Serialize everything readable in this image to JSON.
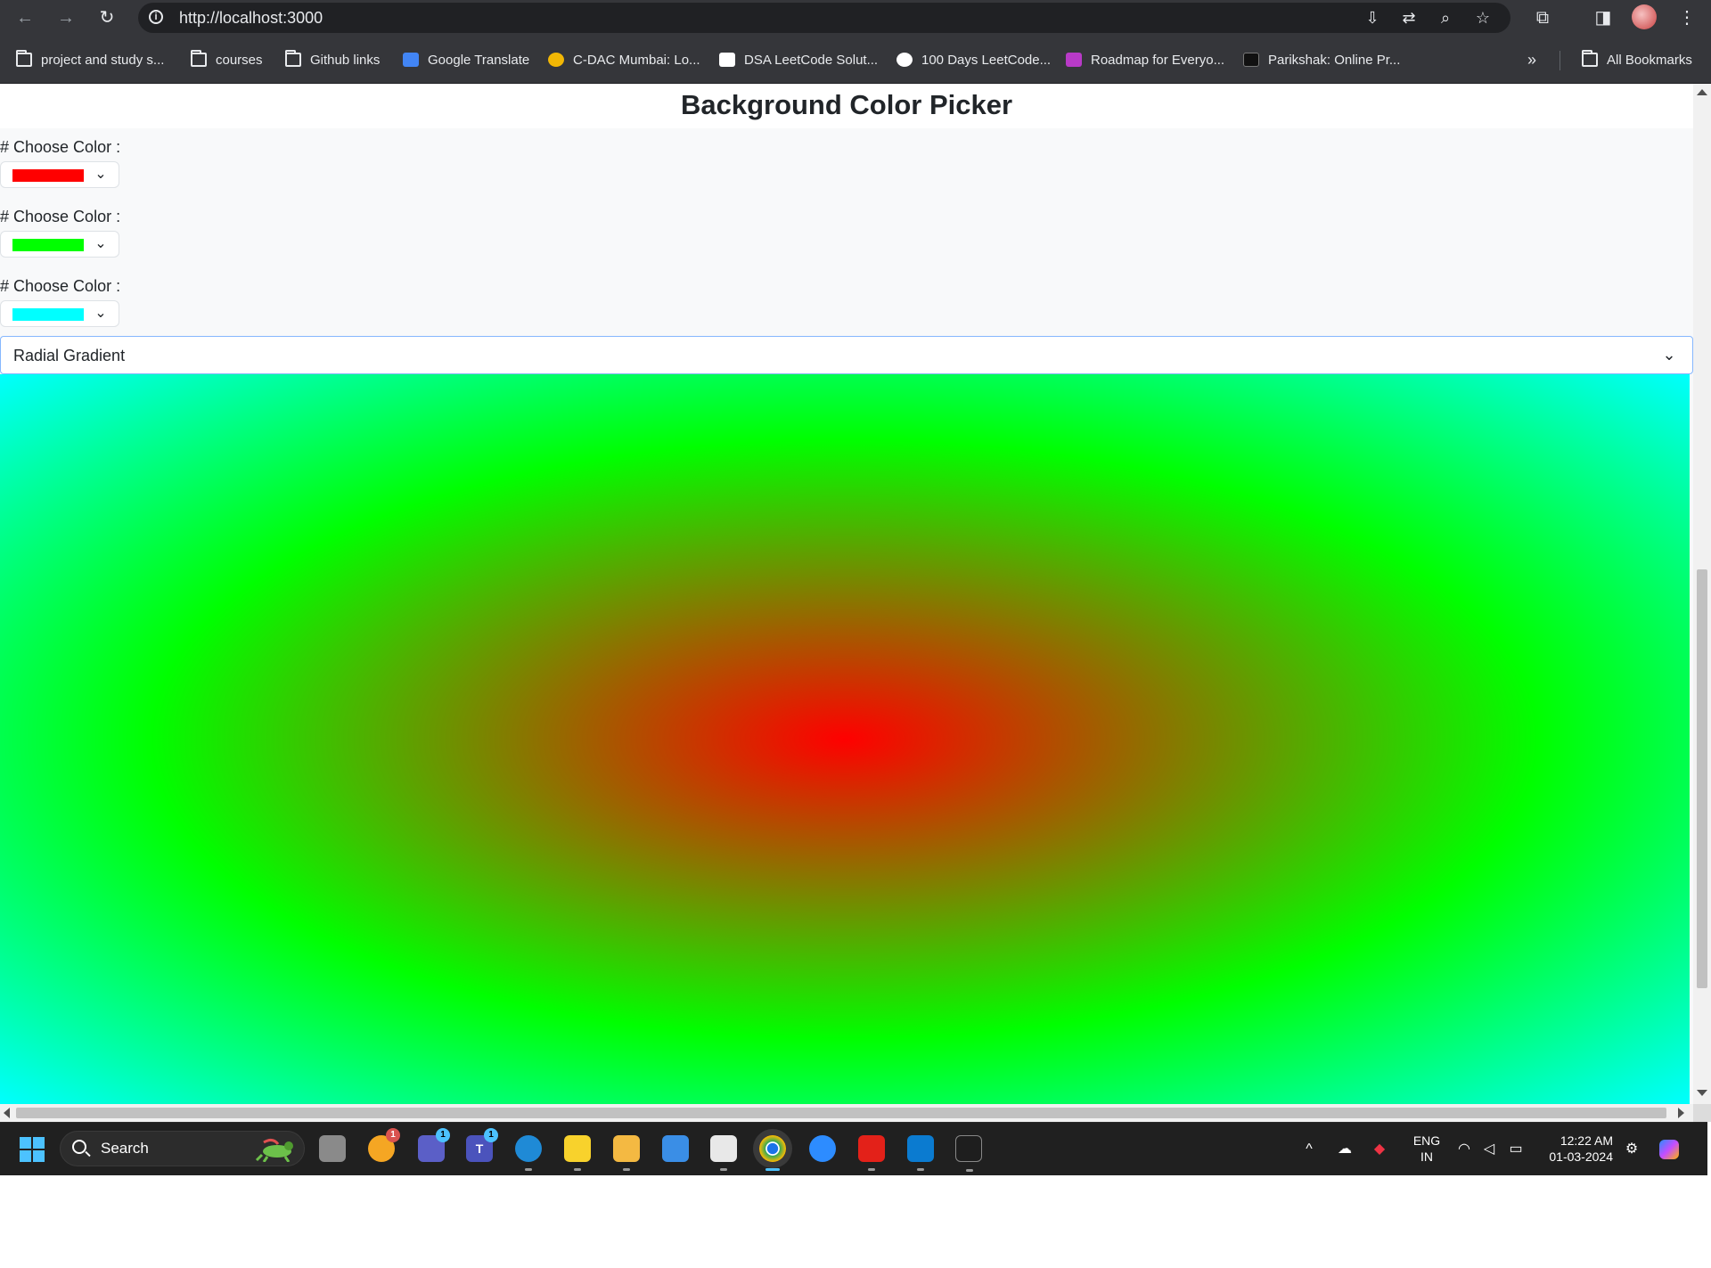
{
  "browser": {
    "url": "http://localhost:3000",
    "bookmarks": [
      "project and study s...",
      "courses",
      "Github links",
      "Google Translate",
      "C-DAC Mumbai: Lo...",
      "DSA LeetCode Solut...",
      "100 Days LeetCode...",
      "Roadmap for Everyo...",
      "Parikshak: Online Pr..."
    ],
    "all_bookmarks": "All Bookmarks"
  },
  "page": {
    "title": "Background Color Picker",
    "pickers": [
      {
        "label": "# Choose Color :",
        "color": "#ff0000"
      },
      {
        "label": "# Choose Color :",
        "color": "#00ff00"
      },
      {
        "label": "# Choose Color :",
        "color": "#00ffff"
      }
    ],
    "gradient_type": "Radial Gradient"
  },
  "taskbar": {
    "search_label": "Search",
    "badges": [
      "1",
      "1",
      "1"
    ],
    "language": [
      "ENG",
      "IN"
    ],
    "time": "12:22 AM",
    "date": "01-03-2024"
  }
}
